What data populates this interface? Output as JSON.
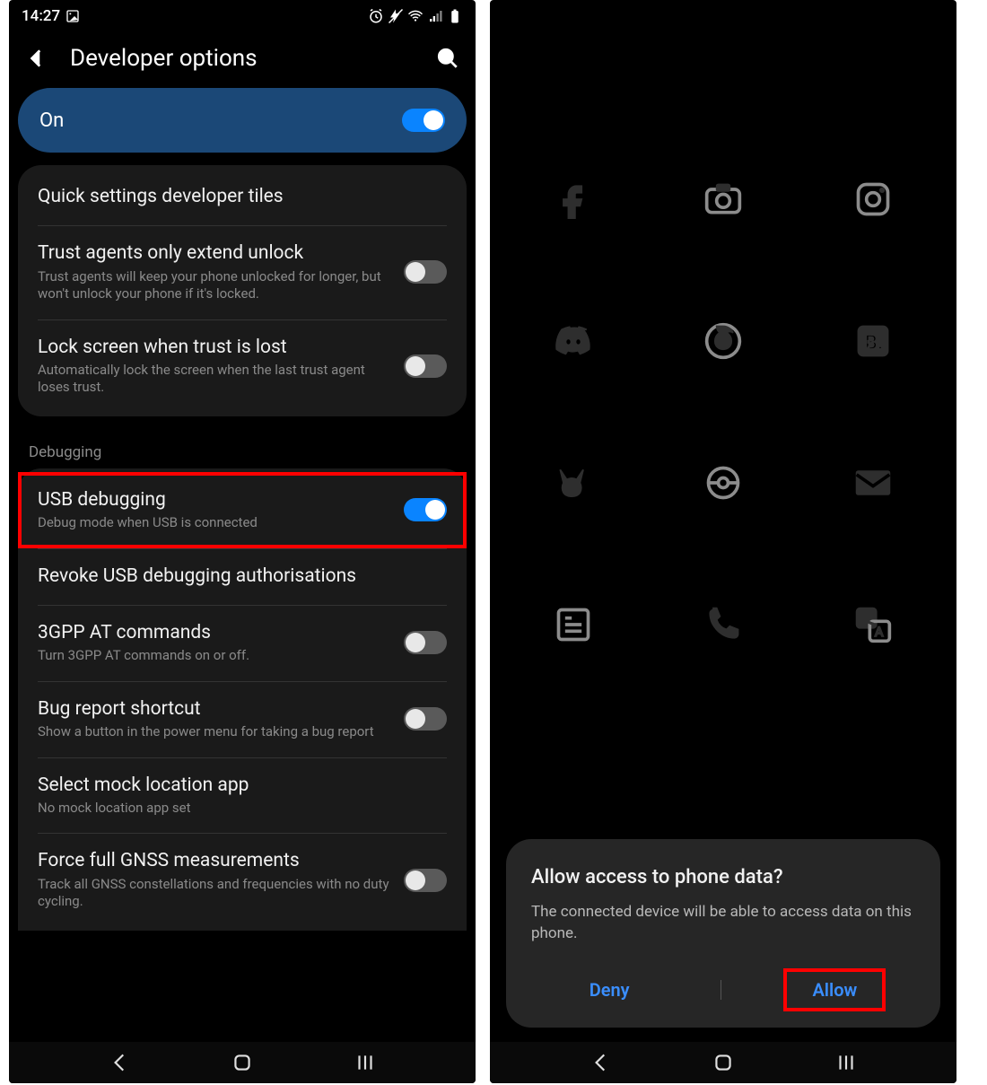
{
  "left": {
    "status": {
      "time": "14:27"
    },
    "header": {
      "title": "Developer options"
    },
    "master": {
      "label": "On",
      "on": true
    },
    "group1": [
      {
        "title": "Quick settings developer tiles",
        "sub": null,
        "toggle": null
      },
      {
        "title": "Trust agents only extend unlock",
        "sub": "Trust agents will keep your phone unlocked for longer, but won't unlock your phone if it's locked.",
        "toggle": false
      },
      {
        "title": "Lock screen when trust is lost",
        "sub": "Automatically lock the screen when the last trust agent loses trust.",
        "toggle": false
      }
    ],
    "section_label": "Debugging",
    "group2": [
      {
        "title": "USB debugging",
        "sub": "Debug mode when USB is connected",
        "toggle": true,
        "hl": true
      },
      {
        "title": "Revoke USB debugging authorisations",
        "sub": null,
        "toggle": null
      },
      {
        "title": "3GPP AT commands",
        "sub": "Turn 3GPP AT commands on or off.",
        "toggle": false
      },
      {
        "title": "Bug report shortcut",
        "sub": "Show a button in the power menu for taking a bug report",
        "toggle": false
      },
      {
        "title": "Select mock location app",
        "sub": "No mock location app set",
        "toggle": null
      },
      {
        "title": "Force full GNSS measurements",
        "sub": "Track all GNSS constellations and frequencies with no duty cycling.",
        "toggle": false
      }
    ]
  },
  "right": {
    "apps": [
      "facebook",
      "camera",
      "instagram",
      "discord",
      "firefox",
      "booking",
      "pikachu",
      "pokeball",
      "mail",
      "gnews",
      "phone",
      "translate"
    ],
    "dialog": {
      "title": "Allow access to phone data?",
      "text": "The connected device will be able to access data on this phone.",
      "deny": "Deny",
      "allow": "Allow"
    }
  }
}
